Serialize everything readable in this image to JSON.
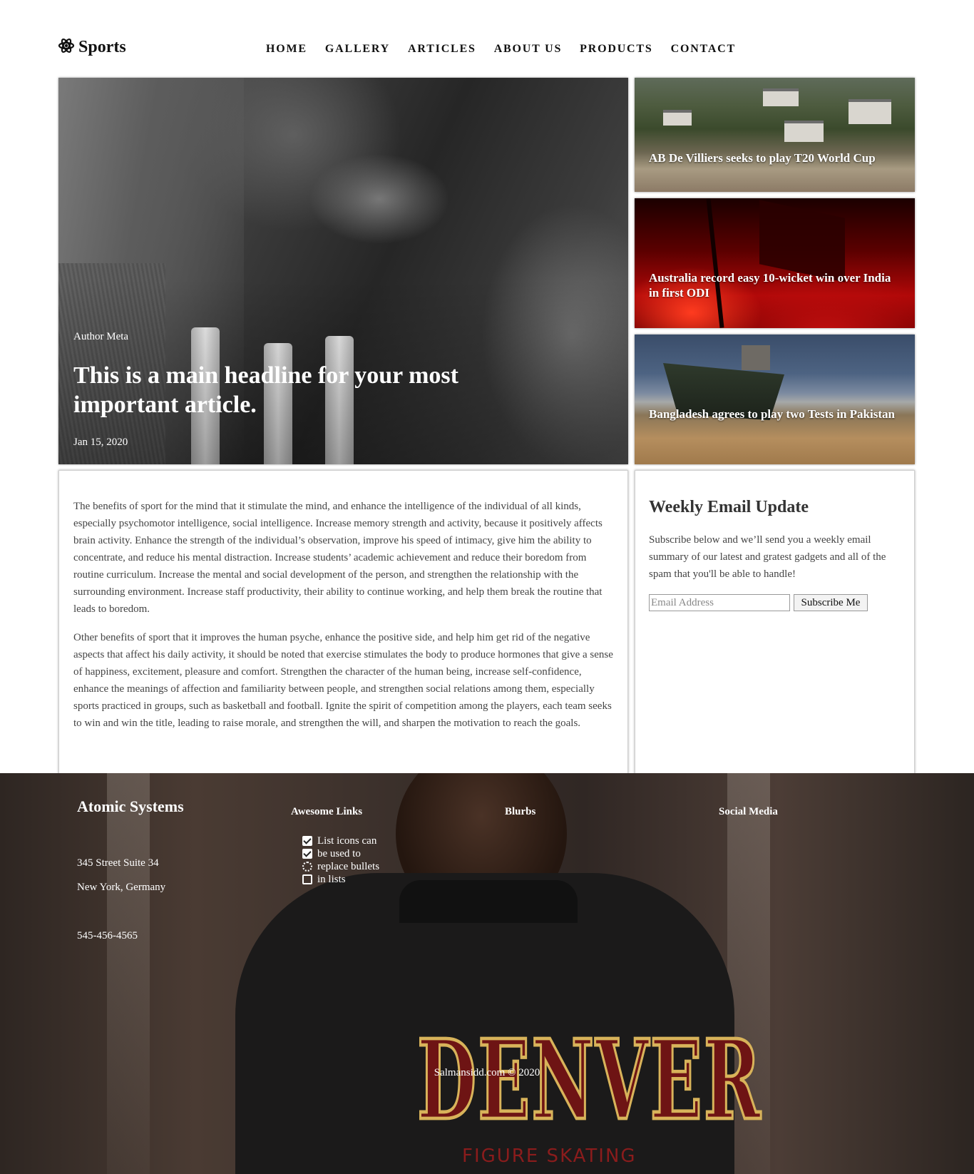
{
  "header": {
    "brand": "Sports",
    "brand_icon": "atom-icon",
    "nav": [
      "HOME",
      "GALLERY",
      "ARTICLES",
      "ABOUT US",
      "PRODUCTS",
      "CONTACT"
    ]
  },
  "hero": {
    "meta": "Author Meta",
    "title": "This is a main headline for your most important article.",
    "date": "Jan 15, 2020"
  },
  "cards": [
    {
      "title": "AB De Villiers seeks to play T20 World Cup"
    },
    {
      "title": "Australia record easy 10-wicket win over India in first ODI"
    },
    {
      "title": "Bangladesh agrees to play two Tests in Pakistan"
    }
  ],
  "article": {
    "paragraphs": [
      "The benefits of sport for the mind that it stimulate the mind, and enhance the intelligence of the individual of all kinds, especially psychomotor intelligence, social intelligence. Increase memory strength and activity, because it positively affects brain activity. Enhance the strength of the individual’s observation, improve his speed of intimacy, give him the ability to concentrate, and reduce his mental distraction. Increase students’ academic achievement and reduce their boredom from routine curriculum. Increase the mental and social development of the person, and strengthen the relationship with the surrounding environment. Increase staff productivity, their ability to continue working, and help them break the routine that leads to boredom.",
      "Other benefits of sport that it improves the human psyche, enhance the positive side, and help him get rid of the negative aspects that affect his daily activity, it should be noted that exercise stimulates the body to produce hormones that give a sense of happiness, excitement, pleasure and comfort. Strengthen the character of the human being, increase self-confidence, enhance the meanings of affection and familiarity between people, and strengthen social relations among them, especially sports practiced in groups, such as basketball and football. Ignite the spirit of competition among the players, each team seeks to win and win the title, leading to raise morale, and strengthen the will, and sharpen the motivation to reach the goals."
    ]
  },
  "newsletter": {
    "title": "Weekly Email Update",
    "text": "Subscribe below and we’ll send you a weekly email summary of our latest and gratest gadgets and all of the spam that you'll be able to handle!",
    "placeholder": "Email Address",
    "button": "Subscribe Me"
  },
  "footer": {
    "brand": "Atomic Systems",
    "address_line1": "345 Street Suite 34",
    "address_line2": "New York, Germany",
    "phone": "545-456-4565",
    "columns": [
      "Awesome Links",
      "Blurbs",
      "Social Media"
    ],
    "list": [
      {
        "icon": "check-square-icon",
        "text": "List icons can"
      },
      {
        "icon": "check-square-icon",
        "text": "be used to"
      },
      {
        "icon": "spinner-icon",
        "text": "replace bullets"
      },
      {
        "icon": "square-icon",
        "text": "in lists"
      }
    ],
    "copyright": "Salmansidd.com © 2020",
    "bg_text_main": "DENVER",
    "bg_text_sub": "FIGURE SKATING"
  }
}
